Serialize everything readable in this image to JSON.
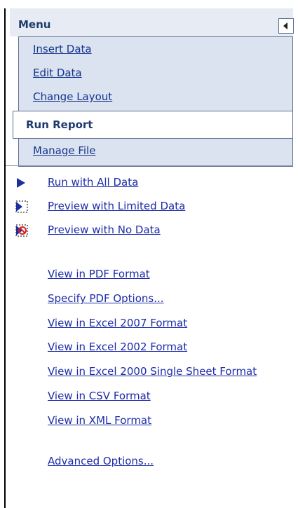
{
  "menu": {
    "title": "Menu",
    "items": [
      {
        "label": "Insert Data"
      },
      {
        "label": "Edit Data"
      },
      {
        "label": "Change Layout"
      },
      {
        "label": "Run Report"
      },
      {
        "label": "Manage File"
      }
    ],
    "active": "Run Report",
    "collapse_icon": "triangle-left-icon"
  },
  "actions": [
    {
      "label": "Run with All Data",
      "icon": "play-arrow-icon"
    },
    {
      "label": "Preview with Limited Data",
      "icon": "preview-limited-icon"
    },
    {
      "label": "Preview with No Data",
      "icon": "preview-none-icon"
    }
  ],
  "options": [
    {
      "label": "View in PDF Format"
    },
    {
      "label": "Specify PDF Options..."
    },
    {
      "label": "View in Excel 2007 Format"
    },
    {
      "label": "View in Excel 2002 Format"
    },
    {
      "label": "View in Excel 2000 Single Sheet Format"
    },
    {
      "label": "View in CSV Format"
    },
    {
      "label": "View in XML Format"
    }
  ],
  "advanced": {
    "label": "Advanced Options..."
  },
  "colors": {
    "link": "#1d2ca8",
    "menu_bg": "#dbe3f0",
    "menu_header_text": "#1f3b6e",
    "border": "#5d6f91"
  }
}
